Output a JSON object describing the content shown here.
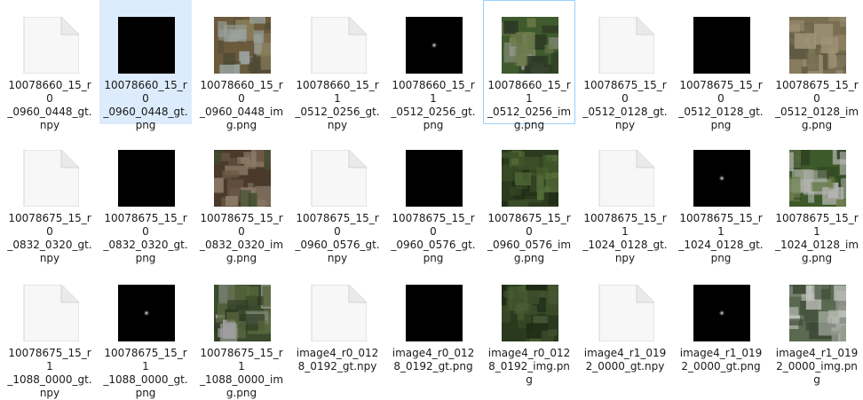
{
  "view": {
    "items": [
      {
        "name": "10078660_15_r0_0960_0448_gt.npy",
        "label_lines": [
          "10078660_15_r0",
          "_0960_0448_gt.",
          "npy"
        ],
        "kind": "doc"
      },
      {
        "name": "10078660_15_r0_0960_0448_gt.png",
        "label_lines": [
          "10078660_15_r0",
          "_0960_0448_gt.",
          "png"
        ],
        "kind": "mask",
        "dot": false,
        "selected": true
      },
      {
        "name": "10078660_15_r0_0960_0448_img.png",
        "label_lines": [
          "10078660_15_r0",
          "_0960_0448_im",
          "g.png"
        ],
        "kind": "photo",
        "palette": [
          "#6b5a3c",
          "#8a7e5a",
          "#9aa4a0",
          "#4f4a36"
        ]
      },
      {
        "name": "10078660_15_r1_0512_0256_gt.npy",
        "label_lines": [
          "10078660_15_r1",
          "_0512_0256_gt.",
          "npy"
        ],
        "kind": "doc"
      },
      {
        "name": "10078660_15_r1_0512_0256_gt.png",
        "label_lines": [
          "10078660_15_r1",
          "_0512_0256_gt.",
          "png"
        ],
        "kind": "mask",
        "dot": true
      },
      {
        "name": "10078660_15_r1_0512_0256_img.png",
        "label_lines": [
          "10078660_15_r1",
          "_0512_0256_im",
          "g.png"
        ],
        "kind": "photo",
        "palette": [
          "#3f5a2c",
          "#6c7a4a",
          "#9c9c98",
          "#2d3a25"
        ],
        "hover": true
      },
      {
        "name": "10078675_15_r0_0512_0128_gt.npy",
        "label_lines": [
          "10078675_15_r0",
          "_0512_0128_gt.",
          "npy"
        ],
        "kind": "doc"
      },
      {
        "name": "10078675_15_r0_0512_0128_gt.png",
        "label_lines": [
          "10078675_15_r0",
          "_0512_0128_gt.",
          "png"
        ],
        "kind": "mask",
        "dot": false
      },
      {
        "name": "10078675_15_r0_0512_0128_img.png",
        "label_lines": [
          "10078675_15_r0",
          "_0512_0128_im",
          "g.png"
        ],
        "kind": "photo",
        "palette": [
          "#7a6e52",
          "#8f8464",
          "#5e5a42",
          "#a09478"
        ]
      },
      {
        "name": "10078675_15_r0_0832_0320_gt.npy",
        "label_lines": [
          "10078675_15_r0",
          "_0832_0320_gt.",
          "npy"
        ],
        "kind": "doc"
      },
      {
        "name": "10078675_15_r0_0832_0320_gt.png",
        "label_lines": [
          "10078675_15_r0",
          "_0832_0320_gt.",
          "png"
        ],
        "kind": "mask",
        "dot": false
      },
      {
        "name": "10078675_15_r0_0832_0320_img.png",
        "label_lines": [
          "10078675_15_r0",
          "_0832_0320_im",
          "g.png"
        ],
        "kind": "photo",
        "palette": [
          "#4a3a2c",
          "#6b5744",
          "#3a4a2a",
          "#8a7a66"
        ]
      },
      {
        "name": "10078675_15_r0_0960_0576_gt.npy",
        "label_lines": [
          "10078675_15_r0",
          "_0960_0576_gt.",
          "npy"
        ],
        "kind": "doc"
      },
      {
        "name": "10078675_15_r0_0960_0576_gt.png",
        "label_lines": [
          "10078675_15_r0",
          "_0960_0576_gt.",
          "png"
        ],
        "kind": "mask",
        "dot": false
      },
      {
        "name": "10078675_15_r0_0960_0576_img.png",
        "label_lines": [
          "10078675_15_r0",
          "_0960_0576_im",
          "g.png"
        ],
        "kind": "photo",
        "palette": [
          "#2c3a1e",
          "#3d5228",
          "#1e2a18",
          "#56703a"
        ]
      },
      {
        "name": "10078675_15_r1_1024_0128_gt.npy",
        "label_lines": [
          "10078675_15_r1",
          "_1024_0128_gt.",
          "npy"
        ],
        "kind": "doc"
      },
      {
        "name": "10078675_15_r1_1024_0128_gt.png",
        "label_lines": [
          "10078675_15_r1",
          "_1024_0128_gt.",
          "png"
        ],
        "kind": "mask",
        "dot": true
      },
      {
        "name": "10078675_15_r1_1024_0128_img.png",
        "label_lines": [
          "10078675_15_r1",
          "_1024_0128_im",
          "g.png"
        ],
        "kind": "photo",
        "palette": [
          "#3d5a2a",
          "#6a7c4c",
          "#b4b4b0",
          "#2a3a20"
        ]
      },
      {
        "name": "10078675_15_r1_1088_0000_gt.npy",
        "label_lines": [
          "10078675_15_r1",
          "_1088_0000_gt.",
          "npy"
        ],
        "kind": "doc"
      },
      {
        "name": "10078675_15_r1_1088_0000_gt.png",
        "label_lines": [
          "10078675_15_r1",
          "_1088_0000_gt.",
          "png"
        ],
        "kind": "mask",
        "dot": true
      },
      {
        "name": "10078675_15_r1_1088_0000_img.png",
        "label_lines": [
          "10078675_15_r1",
          "_1088_0000_im",
          "g.png"
        ],
        "kind": "photo",
        "palette": [
          "#3a4a2c",
          "#a0a0a0",
          "#5a6a40",
          "#2e3a22"
        ]
      },
      {
        "name": "image4_r0_0128_0192_gt.npy",
        "label_lines": [
          "image4_r0_012",
          "8_0192_gt.npy"
        ],
        "kind": "doc"
      },
      {
        "name": "image4_r0_0128_0192_gt.png",
        "label_lines": [
          "image4_r0_012",
          "8_0192_gt.png"
        ],
        "kind": "mask",
        "dot": false
      },
      {
        "name": "image4_r0_0128_0192_img.png",
        "label_lines": [
          "image4_r0_012",
          "8_0192_img.pn",
          "g"
        ],
        "kind": "photo",
        "palette": [
          "#2a3a1e",
          "#3c4e2a",
          "#1c2814",
          "#4a5e34"
        ]
      },
      {
        "name": "image4_r1_0192_0000_gt.npy",
        "label_lines": [
          "image4_r1_019",
          "2_0000_gt.npy"
        ],
        "kind": "doc"
      },
      {
        "name": "image4_r1_0192_0000_gt.png",
        "label_lines": [
          "image4_r1_019",
          "2_0000_gt.png"
        ],
        "kind": "mask",
        "dot": true
      },
      {
        "name": "image4_r1_0192_0000_img.png",
        "label_lines": [
          "image4_r1_019",
          "2_0000_img.pn",
          "g"
        ],
        "kind": "photo",
        "palette": [
          "#5a6a50",
          "#8a8e86",
          "#3e4a36",
          "#c0c2bc"
        ]
      }
    ]
  }
}
